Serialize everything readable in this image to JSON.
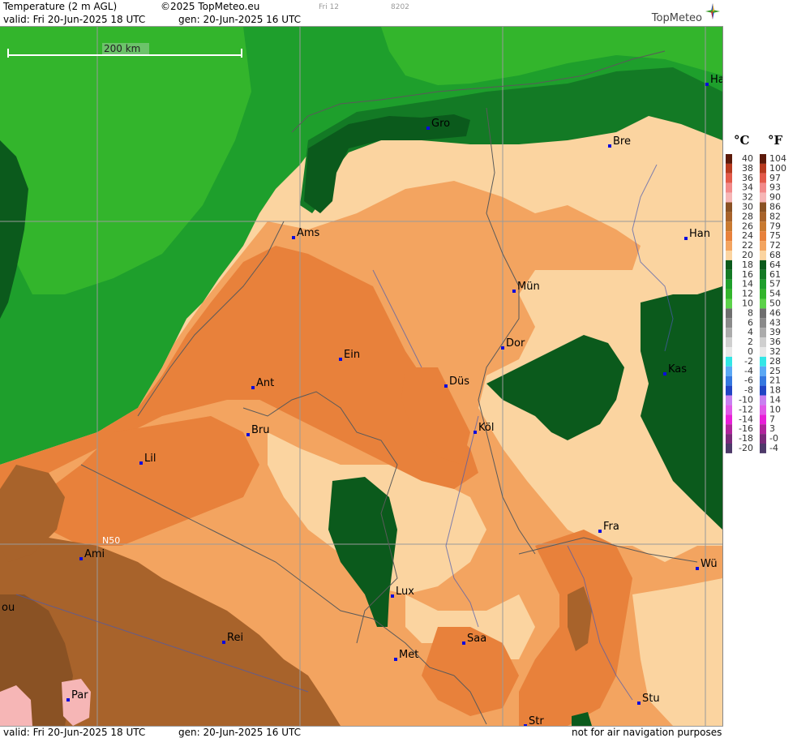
{
  "header": {
    "title": "Temperature (2 m AGL)",
    "copyright": "©2025 TopMeteo.eu",
    "valid": "valid:  Fri  20-Jun-2025  18 UTC",
    "gen": "gen:  20-Jun-2025 16 UTC",
    "small_left": "Fri 12",
    "small_right": "8202",
    "logo": "TopMeteo"
  },
  "map": {
    "scale_label": "200 km",
    "latitude_label": "N50",
    "cities": [
      {
        "label": "Gro"
      },
      {
        "label": "Bre"
      },
      {
        "label": "Ha"
      },
      {
        "label": "Ams"
      },
      {
        "label": "Han"
      },
      {
        "label": "Mün"
      },
      {
        "label": "Dor"
      },
      {
        "label": "Ein"
      },
      {
        "label": "Kas"
      },
      {
        "label": "Ant"
      },
      {
        "label": "Düs"
      },
      {
        "label": "Bru"
      },
      {
        "label": "Köl"
      },
      {
        "label": "Lil"
      },
      {
        "label": "Fra"
      },
      {
        "label": "Ami"
      },
      {
        "label": "Wü"
      },
      {
        "label": "Lux"
      },
      {
        "label": "ou"
      },
      {
        "label": "Rei"
      },
      {
        "label": "Saa"
      },
      {
        "label": "Met"
      },
      {
        "label": "Par"
      },
      {
        "label": "Stu"
      },
      {
        "label": "Str"
      }
    ]
  },
  "legend": {
    "celsius_unit": "°C",
    "fahrenheit_unit": "°F",
    "celsius": [
      "40",
      "38",
      "36",
      "34",
      "32",
      "30",
      "28",
      "26",
      "24",
      "22",
      "20",
      "18",
      "16",
      "14",
      "12",
      "10",
      "8",
      "6",
      "4",
      "2",
      "0",
      "-2",
      "-4",
      "-6",
      "-8",
      "-10",
      "-12",
      "-14",
      "-16",
      "-18",
      "-20"
    ],
    "fahrenheit": [
      "104",
      "100",
      "97",
      "93",
      "90",
      "86",
      "82",
      "79",
      "75",
      "72",
      "68",
      "64",
      "61",
      "57",
      "54",
      "50",
      "46",
      "43",
      "39",
      "36",
      "32",
      "28",
      "25",
      "21",
      "18",
      "14",
      "10",
      "7",
      "3",
      "-0",
      "-4"
    ],
    "colors": [
      "#5c1a0a",
      "#b73a1f",
      "#e35a4a",
      "#f28a8a",
      "#f6b6b6",
      "#8a5224",
      "#a8632b",
      "#c97a30",
      "#e8813b",
      "#f3a460",
      "#fbd4a0",
      "#0b5a1c",
      "#137a25",
      "#1e9f2c",
      "#33b52c",
      "#5cd24a",
      "#6e6e6e",
      "#8a8a8a",
      "#ababab",
      "#cfcfcf",
      "#e8e8e8",
      "#33e6e6",
      "#5aa8f5",
      "#3578e0",
      "#2244c4",
      "#c880f0",
      "#e05ae8",
      "#e81fd8",
      "#b0249c",
      "#7a2a7a",
      "#4e3a6a"
    ]
  },
  "footer": {
    "valid": "valid:  Fri  20-Jun-2025  18 UTC",
    "gen": "gen:  20-Jun-2025 16 UTC",
    "disclaimer": "not for air navigation purposes"
  }
}
